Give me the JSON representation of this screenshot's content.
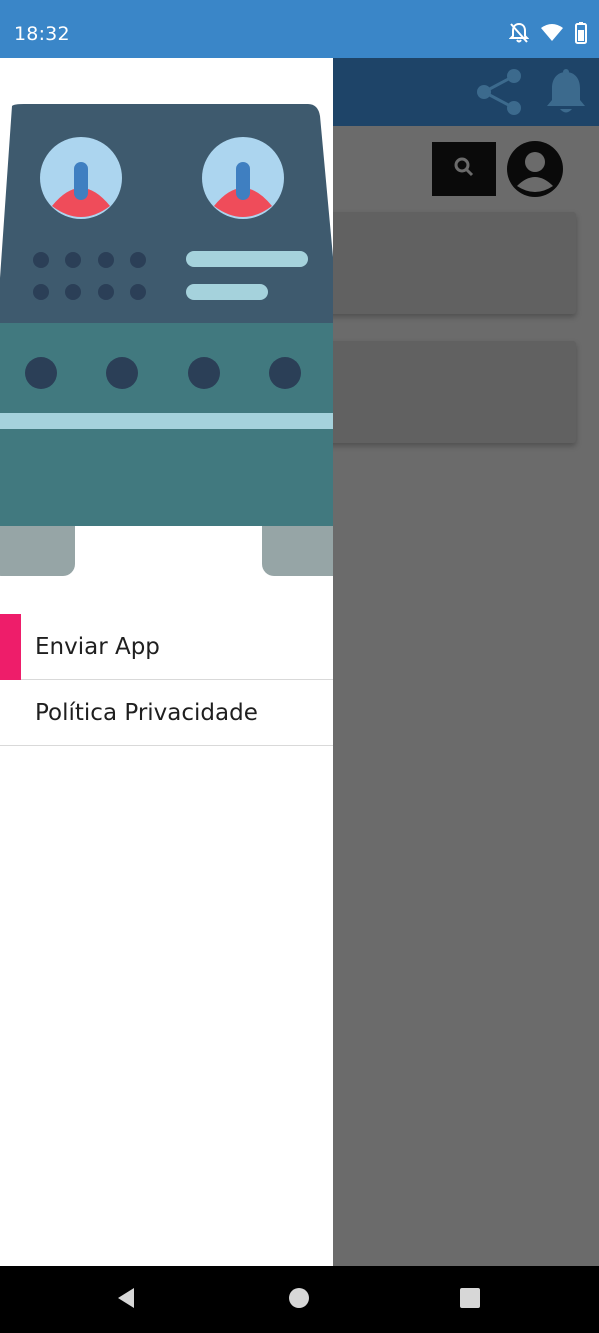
{
  "status_bar": {
    "time": "18:32",
    "icons": [
      "notifications-off-icon",
      "wifi-icon",
      "battery-icon"
    ]
  },
  "toolbar": {
    "icons": [
      "share-icon",
      "bell-icon"
    ]
  },
  "top_actions": {
    "icons": [
      "search-icon",
      "profile-avatar-icon"
    ]
  },
  "drawer": {
    "header_image": "robot-illustration",
    "menu": [
      {
        "label": "Enviar App",
        "active": true
      },
      {
        "label": "Política Privacidade",
        "active": false
      }
    ]
  },
  "colors": {
    "status_bar": "#3a86c8",
    "toolbar": "#1e4468",
    "active_indicator": "#ee1d6a",
    "scrim": "#6b6b6b"
  },
  "nav_bar": {
    "icons": [
      "back-icon",
      "home-icon",
      "recents-icon"
    ]
  }
}
